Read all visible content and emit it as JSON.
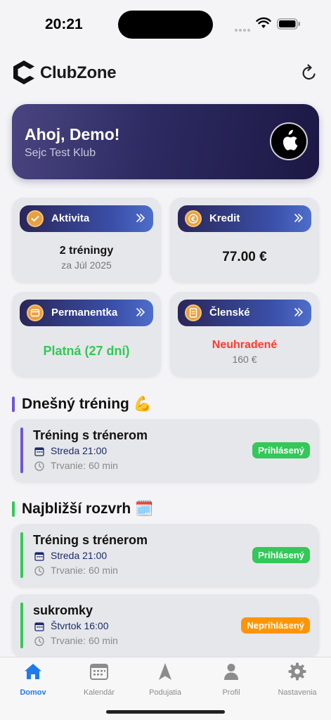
{
  "status_bar": {
    "time": "20:21"
  },
  "header": {
    "app_title": "ClubZone",
    "logo_icon": "clubzone-logo-icon",
    "refresh_icon": "refresh-icon"
  },
  "hero": {
    "greeting": "Ahoj, Demo!",
    "club": "Sejc Test Klub",
    "badge_icon": "apple-logo-icon"
  },
  "stats": {
    "aktivita": {
      "label": "Aktivita",
      "value": "2 tréningy",
      "sub": "za Júl 2025",
      "icon": "check-badge-icon"
    },
    "kredit": {
      "label": "Kredit",
      "value": "77.00 €",
      "icon": "euro-coin-icon"
    },
    "permanentka": {
      "label": "Permanentka",
      "value": "Platná (27 dní)",
      "value_color": "#34c759",
      "icon": "pass-card-icon"
    },
    "clenske": {
      "label": "Členské",
      "value": "Neuhradené",
      "value_color": "#ff3b30",
      "sub": "160 €",
      "icon": "document-icon"
    }
  },
  "today": {
    "title": "Dnešný tréning 💪",
    "accent": "#6e55d6",
    "items": [
      {
        "name": "Tréning s trénerom",
        "date": "Streda 21:00",
        "duration": "Trvanie: 60 min",
        "status": "Prihlásený",
        "status_color": "#34c759"
      }
    ]
  },
  "schedule": {
    "title": "Najbližší rozvrh 🗓️",
    "accent": "#34c759",
    "items": [
      {
        "name": "Tréning s trénerom",
        "date": "Streda 21:00",
        "duration": "Trvanie: 60 min",
        "status": "Prihlásený",
        "status_color": "#34c759"
      },
      {
        "name": "sukromky",
        "date": "Štvrtok 16:00",
        "duration": "Trvanie: 60 min",
        "status": "Neprihlásený",
        "status_color": "#ff9500"
      }
    ]
  },
  "tabs": [
    {
      "label": "Domov",
      "icon": "home-icon",
      "active": true
    },
    {
      "label": "Kalendár",
      "icon": "calendar-icon",
      "active": false
    },
    {
      "label": "Podujatia",
      "icon": "navigation-arrow-icon",
      "active": false
    },
    {
      "label": "Profil",
      "icon": "person-icon",
      "active": false
    },
    {
      "label": "Nastavenia",
      "icon": "gear-icon",
      "active": false
    }
  ],
  "colors": {
    "accent_blue": "#1f7aec",
    "hero_dark": "#1c1844",
    "pill_orange": "#e8a040"
  }
}
